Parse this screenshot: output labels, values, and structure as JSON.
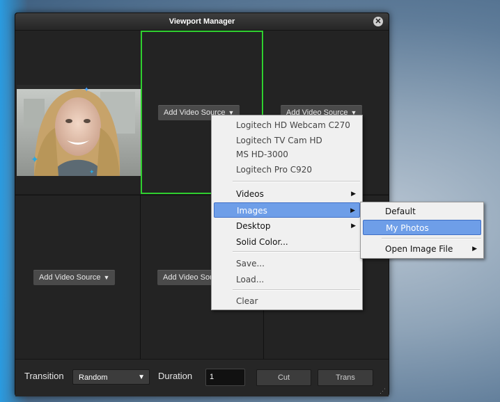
{
  "window": {
    "title": "Viewport Manager"
  },
  "grid": {
    "add_source_label": "Add Video Source"
  },
  "bottom": {
    "transition_label": "Transition",
    "transition_value": "Random",
    "duration_label": "Duration",
    "duration_value": "1",
    "cut_label": "Cut",
    "trans_label": "Trans"
  },
  "context_menu": {
    "devices": [
      "Logitech HD Webcam C270",
      "Logitech TV Cam HD",
      "MS HD-3000",
      "Logitech Pro C920"
    ],
    "videos": "Videos",
    "images": "Images",
    "desktop": "Desktop",
    "solid_color": "Solid Color...",
    "save": "Save...",
    "load": "Load...",
    "clear": "Clear"
  },
  "submenu": {
    "default": "Default",
    "my_photos": "My Photos",
    "open_image_file": "Open Image File"
  },
  "colors": {
    "selected_border": "#2fcf2f",
    "menu_highlight": "#6e9ee8"
  },
  "icons": {
    "close": "close-icon",
    "dropdown_caret": "caret-down-icon",
    "submenu_arrow": "chevron-right-icon",
    "resize_grip": "resize-grip-icon"
  }
}
